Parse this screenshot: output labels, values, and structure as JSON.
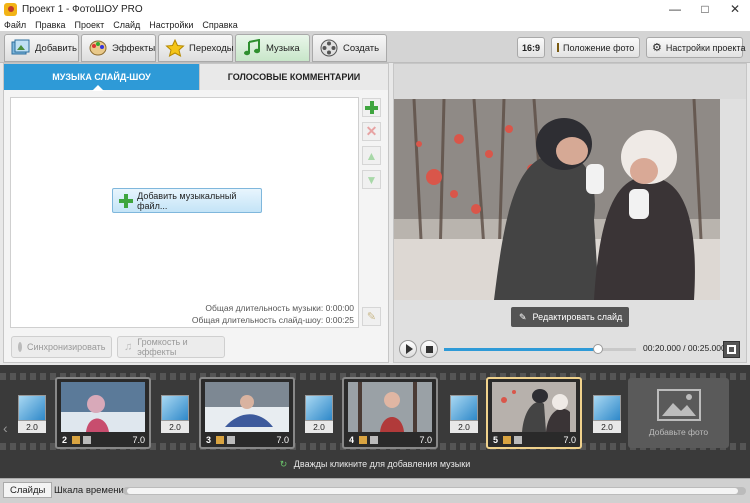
{
  "window": {
    "title": "Проект 1 - ФотоШОУ PRO",
    "controls": [
      "—",
      "□",
      "✕"
    ]
  },
  "menu": [
    "Файл",
    "Правка",
    "Проект",
    "Слайд",
    "Настройки",
    "Справка"
  ],
  "toolbar": {
    "tabs": [
      {
        "label": "Добавить",
        "icon": "add-photos-icon"
      },
      {
        "label": "Эффекты",
        "icon": "effects-palette-icon"
      },
      {
        "label": "Переходы",
        "icon": "transitions-star-icon"
      },
      {
        "label": "Музыка",
        "icon": "music-note-icon",
        "active": true
      },
      {
        "label": "Создать",
        "icon": "film-reel-icon"
      }
    ],
    "aspect_label": "16:9",
    "photo_position_label": "Положение фото",
    "project_settings_label": "Настройки проекта"
  },
  "music_panel": {
    "subtab_music": "МУЗЫКА СЛАЙД-ШОУ",
    "subtab_voice": "ГОЛОСОВЫЕ КОММЕНТАРИИ",
    "add_music_label": "Добавить музыкальный файл...",
    "music_duration_label": "Общая длительность музыки: 0:00:00",
    "slideshow_duration_label": "Общая длительность слайд-шоу: 0:00:25",
    "sync_label": "Синхронизировать",
    "volume_label": "Громкость и эффекты"
  },
  "preview": {
    "edit_slide_label": "Редактировать слайд",
    "time_label": "00:20.000 / 00:25.000",
    "progress": 0.8
  },
  "timeline": {
    "slides": [
      {
        "number": "2",
        "duration": "7.0"
      },
      {
        "number": "3",
        "duration": "7.0"
      },
      {
        "number": "4",
        "duration": "7.0"
      },
      {
        "number": "5",
        "duration": "7.0",
        "selected": true
      }
    ],
    "transitions": [
      "2.0",
      "2.0",
      "2.0",
      "2.0",
      "2.0"
    ],
    "add_photo_label": "Добавьте фото",
    "music_hint": "Дважды кликните для добавления музыки"
  },
  "statusbar": {
    "tab_slides": "Слайды",
    "tab_timeline": "Шкала времени"
  },
  "colors": {
    "accent": "#2e9ad7",
    "selected_frame": "#f0d28c"
  }
}
